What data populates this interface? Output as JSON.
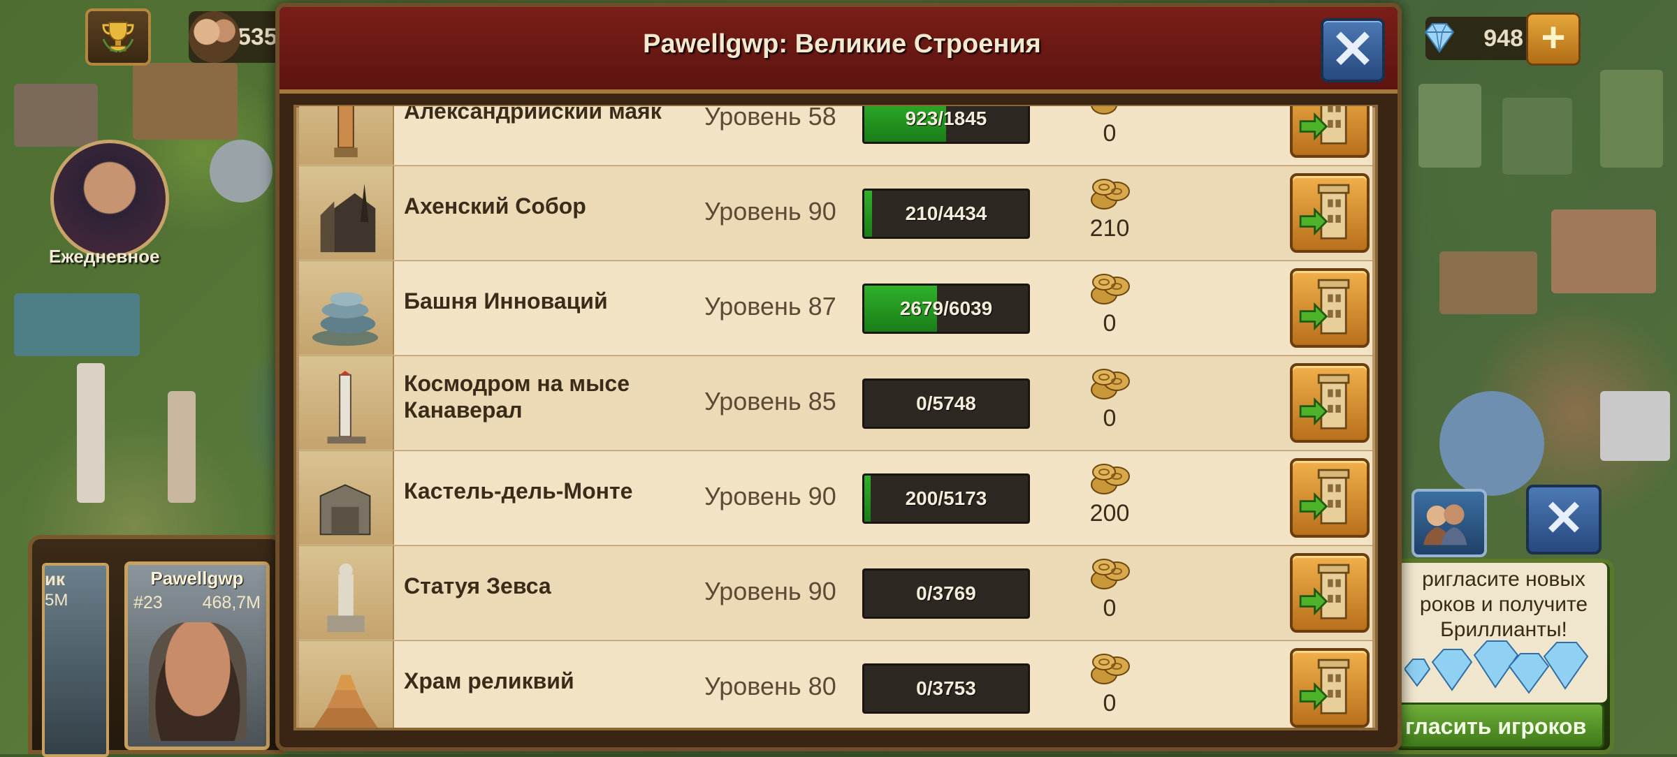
{
  "window": {
    "title": "Pawellgwp: Великие Строения"
  },
  "hud": {
    "population": "535",
    "diamonds": "948",
    "plus_label": "+"
  },
  "daily": {
    "label": "Ежедневное"
  },
  "player_panel": {
    "left_card": {
      "name_fragment": "ик",
      "score_fragment": "5M"
    },
    "card": {
      "name": "Pawellgwp",
      "rank": "#23",
      "score": "468,7M"
    }
  },
  "invite": {
    "text_line1": "ригласите новых",
    "text_line2": "роков и получите",
    "text_line3": "Бриллианты!",
    "button_label": "гласить игроков"
  },
  "buildings": [
    {
      "name": "Александрийский маяк",
      "level": "Уровень 58",
      "progress": "923/1845",
      "current": 923,
      "total": 1845,
      "reward": "0"
    },
    {
      "name": "Ахенский Собор",
      "level": "Уровень 90",
      "progress": "210/4434",
      "current": 210,
      "total": 4434,
      "reward": "210"
    },
    {
      "name": "Башня Инноваций",
      "level": "Уровень 87",
      "progress": "2679/6039",
      "current": 2679,
      "total": 6039,
      "reward": "0"
    },
    {
      "name": "Космодром на мысе Канаверал",
      "level": "Уровень 85",
      "progress": "0/5748",
      "current": 0,
      "total": 5748,
      "reward": "0"
    },
    {
      "name": "Кастель-дель-Монте",
      "level": "Уровень 90",
      "progress": "200/5173",
      "current": 200,
      "total": 5173,
      "reward": "200"
    },
    {
      "name": "Статуя Зевса",
      "level": "Уровень 90",
      "progress": "0/3769",
      "current": 0,
      "total": 3769,
      "reward": "0"
    },
    {
      "name": "Храм реликвий",
      "level": "Уровень 80",
      "progress": "0/3753",
      "current": 0,
      "total": 3753,
      "reward": "0"
    }
  ],
  "colors": {
    "header": "#7a1e18",
    "row": "#f2e3c4",
    "progress_fill": "#2fb12a",
    "close_button": "#4c79b4",
    "action_button": "#f0b04a"
  }
}
